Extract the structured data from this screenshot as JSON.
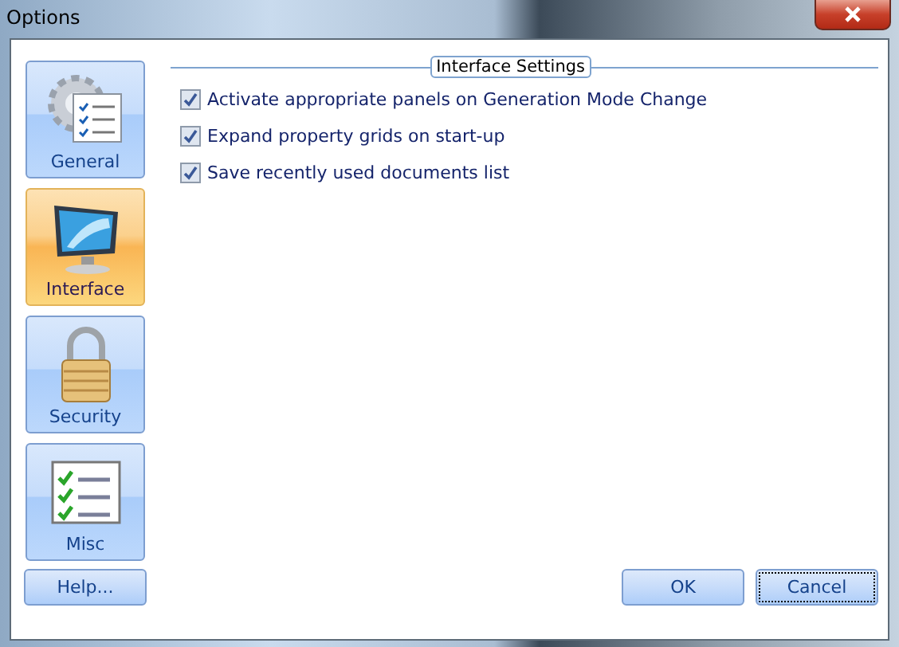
{
  "window": {
    "title": "Options"
  },
  "sidebar": {
    "items": [
      {
        "label": "General",
        "kind": "gear",
        "selected": false
      },
      {
        "label": "Interface",
        "kind": "monitor",
        "selected": true
      },
      {
        "label": "Security",
        "kind": "lock",
        "selected": false
      },
      {
        "label": "Misc",
        "kind": "checklist",
        "selected": false
      }
    ]
  },
  "group": {
    "title": "Interface Settings",
    "options": [
      {
        "label": "Activate appropriate panels on Generation Mode Change",
        "checked": true
      },
      {
        "label": "Expand property grids on start-up",
        "checked": true
      },
      {
        "label": "Save recently used documents list",
        "checked": true
      }
    ]
  },
  "buttons": [
    {
      "label": "Help...",
      "kind": "help",
      "focused": false
    },
    {
      "label": "OK",
      "kind": "ok",
      "focused": false
    },
    {
      "label": "Cancel",
      "kind": "cancel",
      "focused": true
    }
  ]
}
